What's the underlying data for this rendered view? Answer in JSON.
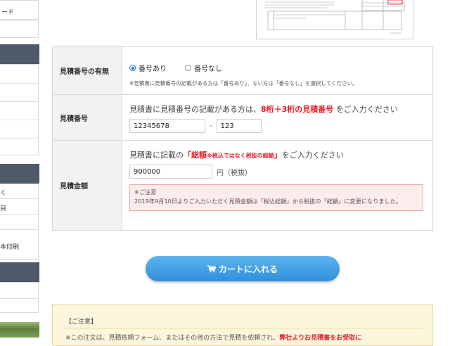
{
  "sidebar": {
    "top_label": "ード",
    "item_a": "く",
    "item_b": "目",
    "item_c": "本印刷"
  },
  "quote_image": {
    "label": "見積書サンプル"
  },
  "form": {
    "row_number_presence": {
      "label": "見積番号の有無",
      "option_yes": "番号あり",
      "option_no": "番号なし",
      "selected": "yes",
      "note": "※見積書に見積番号の記載がある方は「番号あり」、ない方は「番号なし」を選択してください。"
    },
    "row_number": {
      "label": "見積番号",
      "instr_prefix": "見積書に見積番号の記載がある方は、",
      "instr_highlight": "8桁＋3桁の見積番号",
      "instr_suffix": "をご入力ください",
      "value_main": "12345678",
      "dash": "-",
      "value_sub": "123"
    },
    "row_amount": {
      "label": "見積金額",
      "instr_prefix": "見積書に記載の",
      "instr_highlight": "「総額",
      "instr_highlight_small": "※税込ではなく税抜の総額",
      "instr_highlight_close": "」",
      "instr_suffix": "をご入力ください",
      "value": "900000",
      "unit": "円（税抜）",
      "notice_title": "※ご注意",
      "notice_body": "2019年9月10日よりご入力いただく見積金額は「税込総額」から税抜の「総額」に変更になりました。"
    }
  },
  "cart_button": {
    "label": "カートに入れる",
    "icon": "cart-icon"
  },
  "caution": {
    "title": "【ご注意】",
    "text_prefix": "※この注文は、見積依頼フォーム、またはその他の方法で見積を依頼され、",
    "text_highlight": "弊社よりお見積書をお受取に"
  },
  "colors": {
    "accent_blue": "#2f8fdc",
    "highlight_red": "#e8222b",
    "sidebar_header": "#4e5a68",
    "notice_bg": "#fdecec",
    "caution_bg": "#fdf6dc"
  }
}
